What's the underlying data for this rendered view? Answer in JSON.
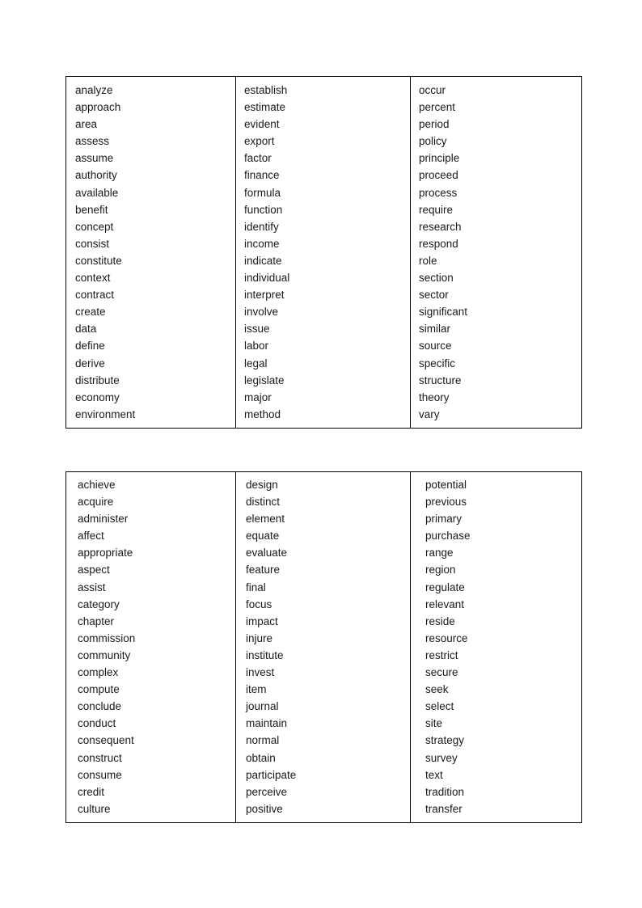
{
  "document": {
    "type": "word-list-document",
    "background_color": "#ffffff",
    "text_color": "#1a1a1a",
    "border_color": "#000000"
  },
  "tables": [
    {
      "name": "academic-word-list-table-1",
      "columns": [
        {
          "name": "column-1",
          "words": [
            "analyze",
            "approach",
            "area",
            "assess",
            "assume",
            "authority",
            "available",
            "benefit",
            "concept",
            "consist",
            "constitute",
            "context",
            "contract",
            "create",
            "data",
            "define",
            "derive",
            "distribute",
            "economy",
            "environment"
          ]
        },
        {
          "name": "column-2",
          "words": [
            "establish",
            "estimate",
            "evident",
            "export",
            "factor",
            "finance",
            "formula",
            "function",
            "identify",
            "income",
            "indicate",
            "individual",
            "interpret",
            "involve",
            "issue",
            "labor",
            "legal",
            "legislate",
            "major",
            "method"
          ]
        },
        {
          "name": "column-3",
          "words": [
            "occur",
            "percent",
            "period",
            "policy",
            "principle",
            "proceed",
            "process",
            "require",
            "research",
            "respond",
            "role",
            "section",
            "sector",
            "significant",
            "similar",
            "source",
            "specific",
            "structure",
            "theory",
            "vary"
          ]
        }
      ]
    },
    {
      "name": "academic-word-list-table-2",
      "columns": [
        {
          "name": "column-1",
          "words": [
            "achieve",
            "acquire",
            "administer",
            "affect",
            "appropriate",
            "aspect",
            "assist",
            "category",
            "chapter",
            "commission",
            "community",
            "complex",
            "compute",
            "conclude",
            "conduct",
            "consequent",
            "construct",
            "consume",
            "credit",
            "culture"
          ]
        },
        {
          "name": "column-2",
          "words": [
            "design",
            "distinct",
            "element",
            "equate",
            "evaluate",
            "feature",
            "final",
            "focus",
            "impact",
            "injure",
            "institute",
            "invest",
            "item",
            "journal",
            "maintain",
            "normal",
            "obtain",
            "participate",
            "perceive",
            "positive"
          ]
        },
        {
          "name": "column-3",
          "words": [
            "potential",
            "previous",
            "primary",
            "purchase",
            "range",
            "region",
            "regulate",
            "relevant",
            "reside",
            "resource",
            "restrict",
            "secure",
            "seek",
            "select",
            "site",
            "strategy",
            "survey",
            "text",
            "tradition",
            "transfer"
          ]
        }
      ]
    }
  ]
}
